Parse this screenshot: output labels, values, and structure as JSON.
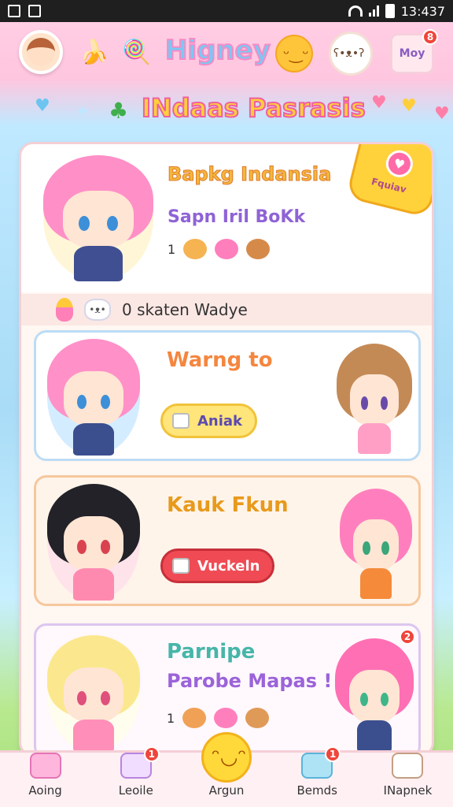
{
  "status_bar": {
    "time": "13:437"
  },
  "header": {
    "title": "Higney",
    "badge_count": "8",
    "right_button_label": "Moy"
  },
  "banner": {
    "title": "INdaas Pasrasis"
  },
  "profile": {
    "name": "Bapkg Indansia",
    "subtitle": "Sapn Iril BoKk",
    "count": "1",
    "ribbon_text": "Fquiav"
  },
  "sub_bar": {
    "text": "0 skaten Wadye"
  },
  "cards": [
    {
      "title": "Warng to",
      "button_label": "Aniak"
    },
    {
      "title": "Kauk Fkun",
      "button_label": "Vuckeln"
    },
    {
      "title": "Parnipe",
      "subtitle": "Parobe Mapas !",
      "count": "1",
      "badge": "2"
    }
  ],
  "nav": [
    {
      "label": "Aoing"
    },
    {
      "label": "Leoile",
      "badge": "1"
    },
    {
      "label": "Argun"
    },
    {
      "label": "Bemds",
      "badge": "1"
    },
    {
      "label": "INapnek"
    }
  ]
}
